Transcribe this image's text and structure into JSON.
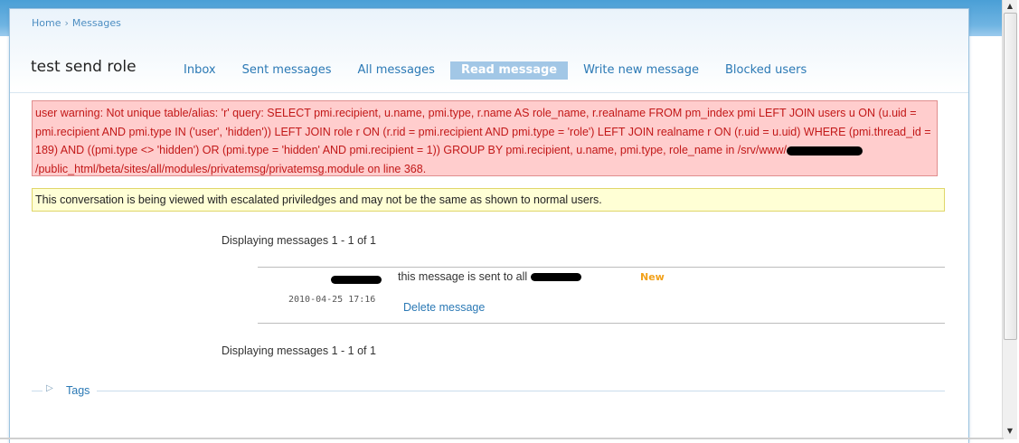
{
  "breadcrumb": {
    "home": "Home",
    "separator": "›",
    "current": "Messages"
  },
  "page": {
    "title": "test send role"
  },
  "tabs": [
    {
      "label": "Inbox",
      "active": false
    },
    {
      "label": "Sent messages",
      "active": false
    },
    {
      "label": "All messages",
      "active": false
    },
    {
      "label": "Read message",
      "active": true
    },
    {
      "label": "Write new message",
      "active": false
    },
    {
      "label": "Blocked users",
      "active": false
    }
  ],
  "error": {
    "text_before_redaction": "user warning: Not unique table/alias: 'r' query: SELECT pmi.recipient, u.name, pmi.type, r.name AS role_name, r.realname FROM pm_index pmi LEFT JOIN users u ON (u.uid = pmi.recipient AND pmi.type IN ('user', 'hidden')) LEFT JOIN role r ON (r.rid = pmi.recipient AND pmi.type = 'role') LEFT JOIN realname r ON (r.uid = u.uid) WHERE (pmi.thread_id = 189) AND ((pmi.type <> 'hidden') OR (pmi.type = 'hidden' AND pmi.recipient = 1)) GROUP BY pmi.recipient, u.name, pmi.type, role_name in /srv/www/",
    "text_after_redaction": "/public_html/beta/sites/all/modules/privatemsg/privatemsg.module on line 368."
  },
  "warning": {
    "text": "This conversation is being viewed with escalated priviledges and may not be the same as shown to normal users."
  },
  "paging": {
    "top": "Displaying messages 1 - 1 of 1",
    "bottom": "Displaying messages 1 - 1 of 1"
  },
  "message": {
    "body": "this message is sent to all",
    "status": "New",
    "date": "2010-04-25 17:16",
    "delete_label": "Delete message"
  },
  "tags": {
    "label": "Tags",
    "arrow": "▷"
  },
  "colors": {
    "link": "#2b79b5",
    "error_bg": "#ffcdcd",
    "error_text": "#c21818",
    "warning_bg": "#ffffd5",
    "new_badge": "#f2a11b",
    "active_tab_bg": "#a2c7e6"
  }
}
